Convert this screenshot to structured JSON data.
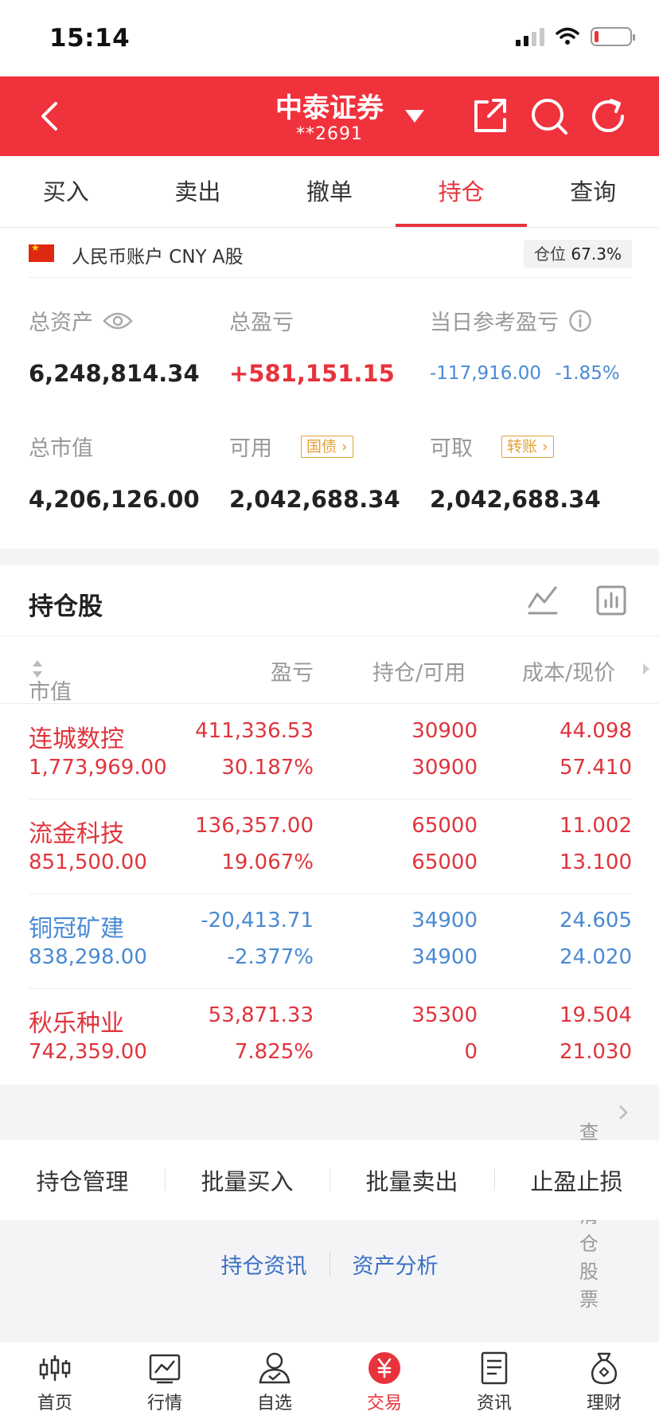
{
  "status_bar": {
    "time": "15:14"
  },
  "header": {
    "broker": "中泰证券",
    "account_id": "**2691"
  },
  "tabs": [
    "买入",
    "卖出",
    "撤单",
    "持仓",
    "查询"
  ],
  "active_tab": "持仓",
  "account": {
    "name": "人民币账户 CNY A股",
    "position_label": "仓位",
    "position_value": "67.3%"
  },
  "metrics": {
    "total_assets": {
      "label": "总资产",
      "value": "6,248,814.34"
    },
    "total_pnl": {
      "label": "总盈亏",
      "value": "+581,151.15"
    },
    "daily_pnl": {
      "label": "当日参考盈亏",
      "value": "-117,916.00",
      "pct": "-1.85%"
    },
    "market_value": {
      "label": "总市值",
      "value": "4,206,126.00"
    },
    "available": {
      "label": "可用",
      "tag": "国债",
      "value": "2,042,688.34"
    },
    "withdrawable": {
      "label": "可取",
      "tag": "转账",
      "value": "2,042,688.34"
    }
  },
  "holdings": {
    "title": "持仓股",
    "columns": {
      "market_value": "市值",
      "pnl": "盈亏",
      "position": "持仓/可用",
      "cost_price": "成本/现价"
    },
    "rows": [
      {
        "name": "连城数控",
        "market_value": "1,773,969.00",
        "pnl": "411,336.53",
        "pnl_pct": "30.187%",
        "position": "30900",
        "available": "30900",
        "cost": "44.098",
        "price": "57.410",
        "color": "#e0343c"
      },
      {
        "name": "流金科技",
        "market_value": "851,500.00",
        "pnl": "136,357.00",
        "pnl_pct": "19.067%",
        "position": "65000",
        "available": "65000",
        "cost": "11.002",
        "price": "13.100",
        "color": "#e0343c"
      },
      {
        "name": "铜冠矿建",
        "market_value": "838,298.00",
        "pnl": "-20,413.71",
        "pnl_pct": "-2.377%",
        "position": "34900",
        "available": "34900",
        "cost": "24.605",
        "price": "24.020",
        "color": "#4a8ad4"
      },
      {
        "name": "秋乐种业",
        "market_value": "742,359.00",
        "pnl": "53,871.33",
        "pnl_pct": "7.825%",
        "position": "35300",
        "available": "0",
        "cost": "19.504",
        "price": "21.030",
        "color": "#e0343c"
      }
    ]
  },
  "view_cleared": "查看已清仓股票",
  "actions": [
    "持仓管理",
    "批量买入",
    "批量卖出",
    "止盈止损"
  ],
  "info_links": [
    "持仓资讯",
    "资产分析"
  ],
  "bottom_nav": [
    "首页",
    "行情",
    "自选",
    "交易",
    "资讯",
    "理财"
  ],
  "bottom_nav_active": "交易",
  "colors": {
    "brand_red": "#f0323c",
    "rise": "#e0343c",
    "fall": "#4a8ad4",
    "tag": "#e3a03a"
  }
}
